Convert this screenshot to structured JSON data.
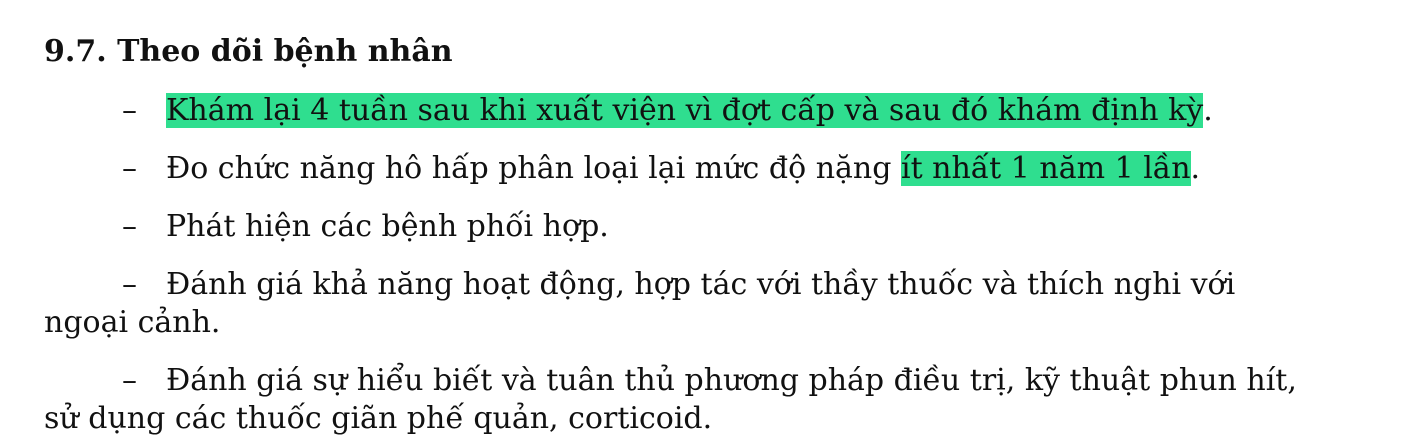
{
  "section": {
    "heading": "9.7. Theo dõi bệnh nhân",
    "highlight_color": "#2fde8f",
    "items": [
      {
        "dash": "–",
        "highlighted": "Khám lại 4 tuần sau khi xuất viện vì đợt cấp và sau đó khám định kỳ",
        "after": "."
      },
      {
        "dash": "–",
        "before": "Đo chức năng hô hấp phân loại lại mức độ nặng ",
        "highlighted": "ít nhất 1 năm 1 lần",
        "after": "."
      },
      {
        "dash": "–",
        "text": "Phát hiện các bệnh phối hợp."
      },
      {
        "dash": "–",
        "text": "Đánh giá khả năng hoạt động, hợp tác với thầy thuốc và thích nghi với ngoại cảnh."
      },
      {
        "dash": "–",
        "text": "Đánh giá sự hiểu biết và tuân thủ phương pháp điều trị, kỹ thuật phun hít, sử dụng các thuốc giãn phế quản, corticoid."
      }
    ]
  }
}
